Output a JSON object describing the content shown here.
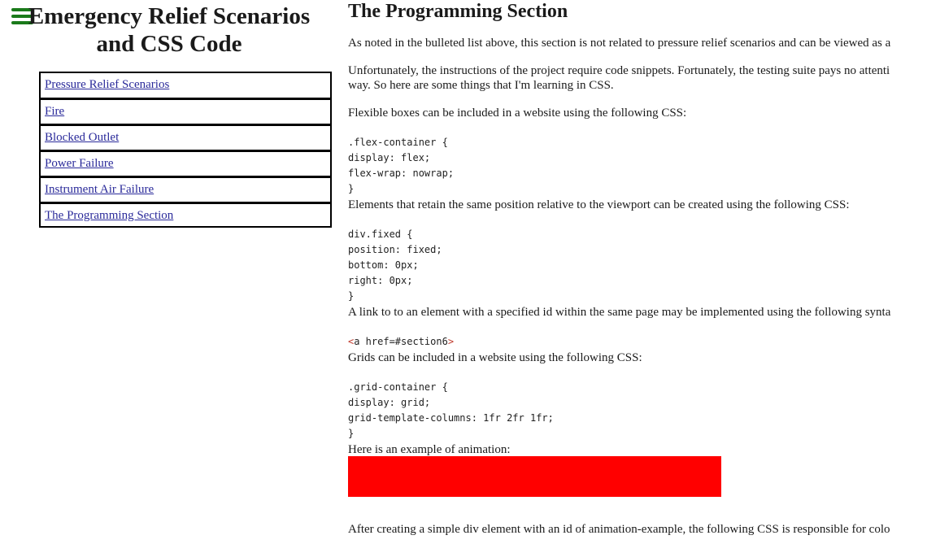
{
  "nav": {
    "title": "Emergency Relief Scenarios and CSS Code",
    "menu_icon": "hamburger-menu-icon",
    "items": [
      {
        "label": "Pressure Relief Scenarios"
      },
      {
        "label": "Fire"
      },
      {
        "label": "Blocked Outlet"
      },
      {
        "label": "Power Failure"
      },
      {
        "label": "Instrument Air Failure"
      },
      {
        "label": "The Programming Section"
      }
    ]
  },
  "section": {
    "title": "The Programming Section",
    "intro": "As noted in the bulleted list above, this section is not related to pressure relief scenarios and can be viewed as a",
    "unfortunately_1": "Unfortunately, the instructions of the project require code snippets. Fortunately, the testing suite pays no attenti",
    "unfortunately_2": "way. So here are some things that I'm learning in CSS.",
    "flex_intro": "Flexible boxes can be included in a website using the following CSS:",
    "flex_code": [
      ".flex-container {",
      "display: flex;",
      "flex-wrap: nowrap;",
      "}"
    ],
    "fixed_intro": "Elements that retain the same position relative to the viewport can be created using the following CSS:",
    "fixed_code": [
      "div.fixed {",
      "position: fixed;",
      "bottom: 0px;",
      "right: 0px;",
      "}"
    ],
    "link_intro": "A link to to an element with a specified id within the same page may be implemented using the following synta",
    "link_code_tag_open": "<",
    "link_code_body": "a href=#section6",
    "link_code_tag_close": ">",
    "grid_intro": "Grids can be included in a website using the following CSS:",
    "grid_code": [
      ".grid-container {",
      "display: grid;",
      "grid-template-columns: 1fr 2fr 1fr;",
      "}"
    ],
    "anim_intro": "Here is an example of animation:",
    "anim_color": "#ff0000",
    "after_anim": "After creating a simple div element with an id of animation-example, the following CSS is responsible for colo"
  }
}
